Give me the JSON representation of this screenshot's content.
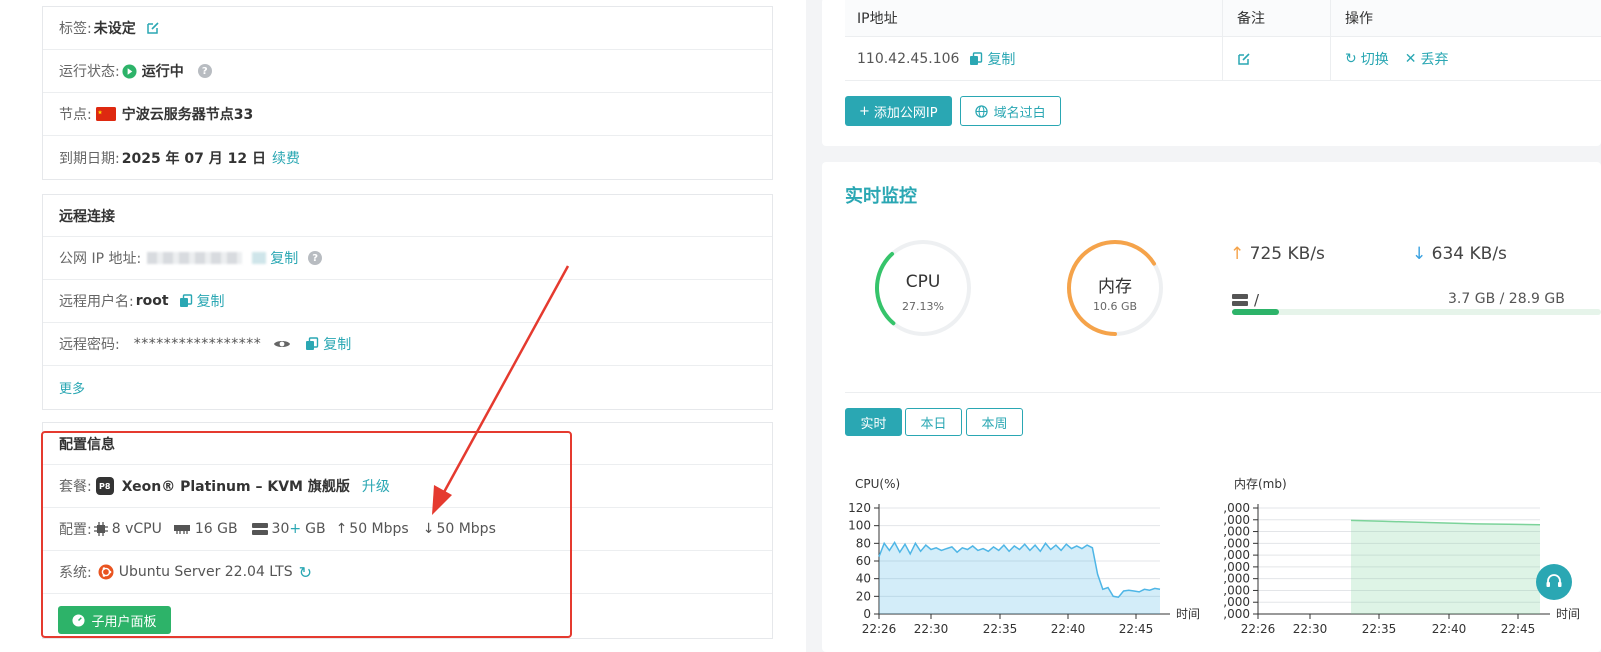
{
  "basic": {
    "tag_label": "标签:",
    "tag_value": "未设定",
    "status_label": "运行状态:",
    "status_value": "运行中",
    "node_label": "节点:",
    "node_value": "宁波云服务器节点33",
    "expire_label": "到期日期:",
    "expire_value": "2025 年 07 月 12 日",
    "renew_link": "续费"
  },
  "remote": {
    "title": "远程连接",
    "ip_label": "公网 IP 地址:",
    "copy": "复制",
    "user_label": "远程用户名:",
    "user_value": "root",
    "pwd_label": "远程密码:",
    "pwd_value": "*****************",
    "more": "更多"
  },
  "config": {
    "title": "配置信息",
    "plan_label": "套餐:",
    "plan_badge": "P8",
    "plan_value": "Xeon® Platinum – KVM 旗舰版",
    "upgrade_link": "升级",
    "spec_label": "配置:",
    "cpu": "8 vCPU",
    "ram": "16 GB",
    "disk": "30",
    "disk_plus": "+",
    "disk_unit": "GB",
    "up": "50 Mbps",
    "down": "50 Mbps",
    "os_label": "系统:",
    "os_value": "Ubuntu Server 22.04 LTS",
    "subuser_button": "子用户面板"
  },
  "ip_table": {
    "headers": [
      "IP地址",
      "备注",
      "操作"
    ],
    "ip": "110.42.45.106",
    "copy": "复制",
    "switch": "切换",
    "discard": "丢弃",
    "add_button": "添加公网IP",
    "domain_button": "域名过白"
  },
  "monitor": {
    "title": "实时监控",
    "cpu_label": "CPU",
    "cpu_value": "27.13%",
    "cpu_fraction": 0.2713,
    "mem_label": "内存",
    "mem_value": "10.6 GB",
    "mem_fraction": 0.66,
    "up_speed": "725 KB/s",
    "down_speed": "634 KB/s",
    "disk_mount": "/",
    "disk_usage": "3.7 GB / 28.9 GB",
    "disk_fraction": 0.128,
    "tabs": [
      "实时",
      "本日",
      "本周"
    ],
    "colors": {
      "accent": "#2aa7b3",
      "cpu": "#36c46b",
      "mem": "#f5a34a",
      "up": "#f5a34a",
      "down": "#3aa1e0"
    }
  },
  "chart_data": [
    {
      "type": "area",
      "title": "CPU(%)",
      "xlabel": "时间",
      "x_ticks": [
        "22:26",
        "22:30",
        "22:35",
        "22:40",
        "22:45"
      ],
      "y_ticks": [
        "0",
        "20",
        "40",
        "60",
        "80",
        "100",
        "120"
      ],
      "ylim": [
        0,
        120
      ],
      "grid": true,
      "color": "#4fb6e6",
      "series": [
        {
          "values": [
            65,
            80,
            72,
            81,
            70,
            79,
            68,
            80,
            71,
            78,
            73,
            75,
            72,
            74,
            76,
            70,
            75,
            73,
            77,
            72,
            74,
            71,
            76,
            72,
            78,
            71,
            77,
            73,
            79,
            72,
            78,
            71,
            80,
            73,
            78,
            72,
            79,
            74,
            77,
            74,
            78,
            75,
            45,
            28,
            30,
            20,
            19,
            26,
            27,
            26,
            25,
            28,
            27,
            29,
            28
          ]
        }
      ]
    },
    {
      "type": "area",
      "title": "内存(mb)",
      "xlabel": "时间",
      "x_ticks": [
        "22:26",
        "22:30",
        "22:35",
        "22:40",
        "22:45"
      ],
      "y_ticks": [
        ",000",
        ",000",
        ",000",
        ",000",
        ",000",
        ",000",
        ",000",
        ",000",
        ",000",
        ",000"
      ],
      "grid": true,
      "color": "#7cd39a",
      "series": [
        {
          "values": [
            10600,
            10500,
            10400,
            10300,
            10200,
            10150,
            10100
          ]
        }
      ]
    }
  ]
}
